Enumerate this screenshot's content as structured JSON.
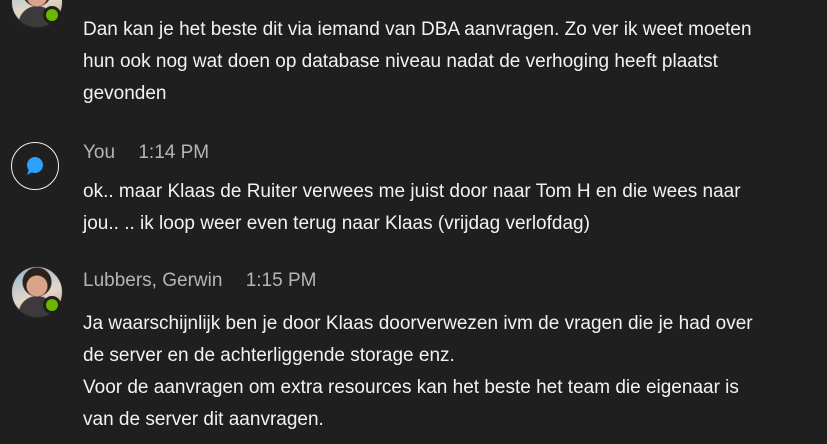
{
  "messages": [
    {
      "sender": "",
      "time": "",
      "lines": [
        "Dan kan je het beste dit via iemand van DBA aanvragen. Zo ver ik weet moeten",
        "hun ook nog wat doen op database niveau nadat de verhoging heeft plaatst",
        "gevonden"
      ]
    },
    {
      "sender": "You",
      "time": "1:14 PM",
      "lines": [
        "ok.. maar Klaas de Ruiter verwees me juist door naar Tom H en die wees naar",
        "jou.. .. ik loop weer even terug naar Klaas (vrijdag verlofdag)"
      ]
    },
    {
      "sender": "Lubbers, Gerwin",
      "time": "1:15 PM",
      "lines": [
        "Ja waarschijnlijk ben je door Klaas doorverwezen ivm de vragen die je had over",
        "de server en de achterliggende storage enz.",
        "Voor de aanvragen om extra resources kan het beste het team die eigenaar is",
        "van de server dit aanvragen."
      ]
    }
  ],
  "colors": {
    "background": "#1f1f1f",
    "presence_available": "#6bb700",
    "self_icon": "#2aa0ff",
    "meta_text": "#b5b5b5",
    "body_text": "#f2f2f2"
  },
  "icons": {
    "self_avatar": "chat-bubble-icon",
    "presence": "presence-available-icon"
  }
}
